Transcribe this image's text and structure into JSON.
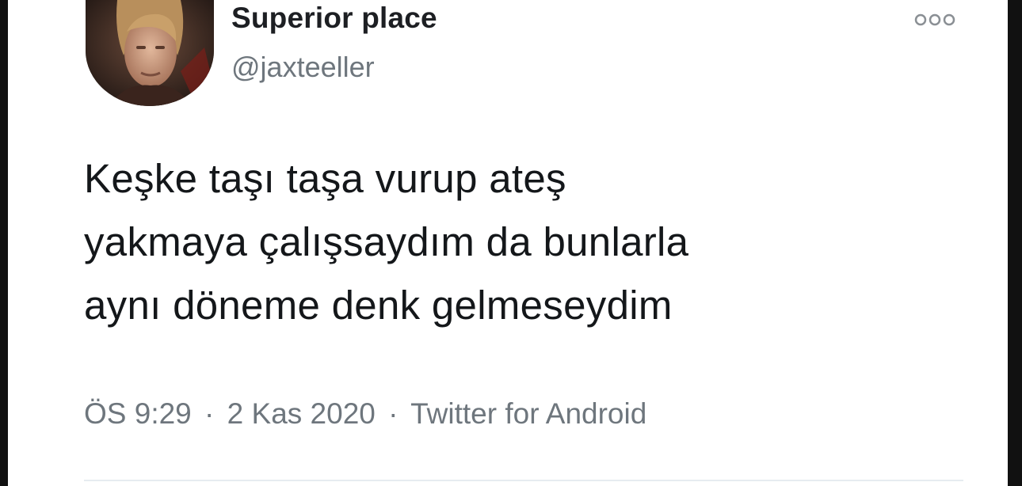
{
  "tweet": {
    "display_name": "Superior place",
    "handle": "@jaxteeller",
    "text_lines": [
      "Keşke taşı taşa vurup ateş",
      "yakmaya çalışsaydım da bunlarla",
      "aynı döneme denk gelmeseydim"
    ],
    "time": "ÖS 9:29",
    "date": "2 Kas 2020",
    "source": "Twitter for Android",
    "separator": "·"
  },
  "icons": {
    "more": "more-options-icon",
    "avatar": "profile-photo"
  },
  "colors": {
    "text": "#14171a",
    "secondary": "#6e767d",
    "background": "#ffffff"
  }
}
